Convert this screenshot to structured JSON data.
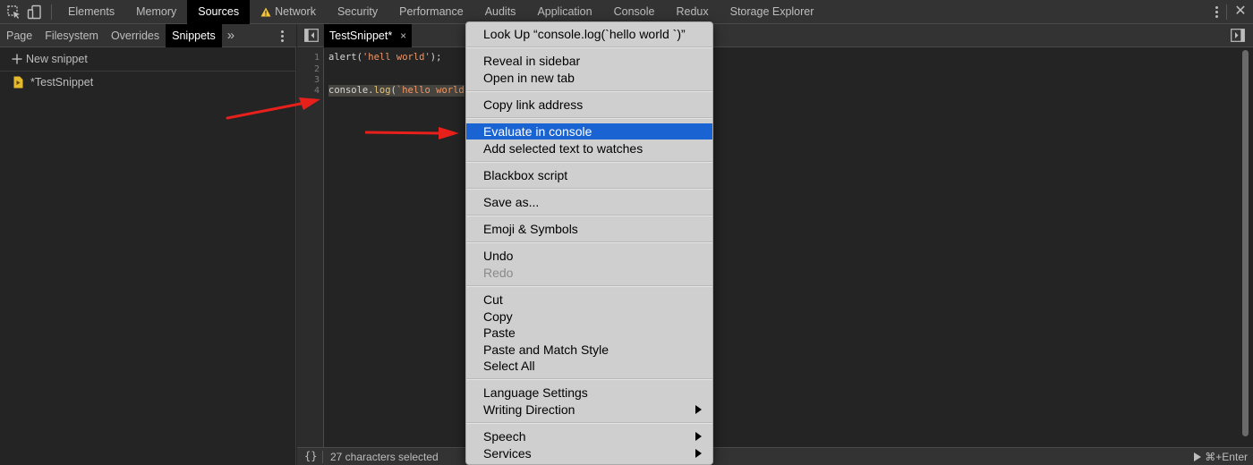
{
  "top_tabs": [
    "Elements",
    "Memory",
    "Sources",
    "Network",
    "Security",
    "Performance",
    "Audits",
    "Application",
    "Console",
    "Redux",
    "Storage Explorer"
  ],
  "navigator": {
    "tabs": [
      "Page",
      "Filesystem",
      "Overrides",
      "Snippets"
    ],
    "more": "»",
    "new_snippet": "New snippet",
    "item": "*TestSnippet"
  },
  "editor": {
    "tab": "TestSnippet*",
    "tab_close": "×",
    "line_numbers": [
      "1",
      "2",
      "3",
      "4"
    ],
    "line1": {
      "a": "alert(",
      "b": "'hell world'",
      "c": ");"
    },
    "line4": {
      "a": "console.",
      "b": "log",
      "c": "(",
      "d": "`hello world"
    }
  },
  "status": {
    "pretty": "{}",
    "text": "27 characters selected",
    "run": "⌘+Enter"
  },
  "context_menu": {
    "look_up": "Look Up “console.log(`hello world `)”",
    "reveal": "Reveal in sidebar",
    "open_tab": "Open in new tab",
    "copy_link": "Copy link address",
    "evaluate": "Evaluate in console",
    "add_watch": "Add selected text to watches",
    "blackbox": "Blackbox script",
    "save_as": "Save as...",
    "emoji": "Emoji & Symbols",
    "undo": "Undo",
    "redo": "Redo",
    "cut": "Cut",
    "copy": "Copy",
    "paste": "Paste",
    "paste_match": "Paste and Match Style",
    "select_all": "Select All",
    "language": "Language Settings",
    "writing": "Writing Direction",
    "speech": "Speech",
    "services": "Services"
  },
  "colors": {
    "highlight": "#1a63d3",
    "annotation_arrow": "#e8201c",
    "active_tab": "#000000",
    "string": "#f29766"
  }
}
